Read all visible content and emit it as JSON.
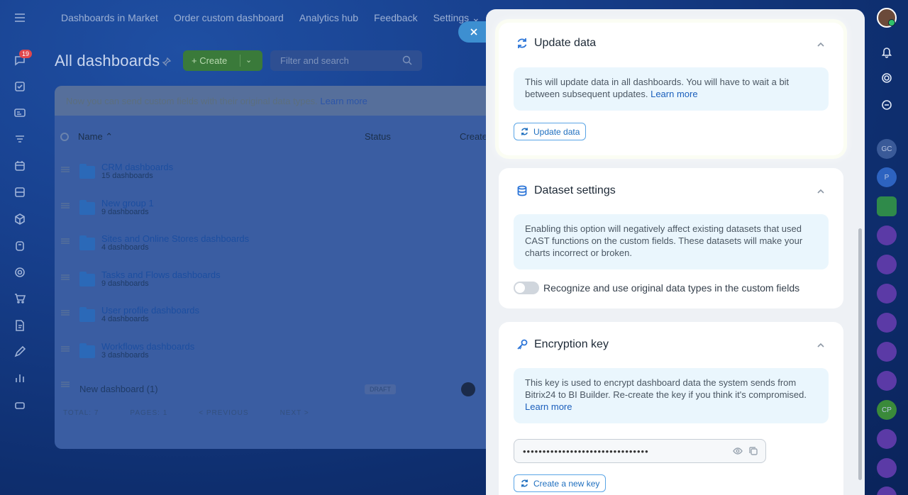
{
  "topnav": {
    "items": [
      "Dashboards in Market",
      "Order custom dashboard",
      "Analytics hub",
      "Feedback",
      "Settings ⌄"
    ]
  },
  "leftrail": {
    "badge_count": "19"
  },
  "page": {
    "title": "All dashboards",
    "create_label": "+ Create",
    "search_placeholder": "Filter and search"
  },
  "notice": {
    "text": "Now you can send custom fields with their original data types. ",
    "link": "Learn more"
  },
  "table": {
    "col_name": "Name ⌃",
    "col_status": "Status",
    "col_created": "Create",
    "rows": [
      {
        "name": "CRM dashboards",
        "sub": "15 dashboards"
      },
      {
        "name": "New group 1",
        "sub": "9 dashboards"
      },
      {
        "name": "Sites and Online Stores dashboards",
        "sub": "4 dashboards"
      },
      {
        "name": "Tasks and Flows dashboards",
        "sub": "9 dashboards"
      },
      {
        "name": "User profile dashboards",
        "sub": "4 dashboards"
      },
      {
        "name": "Workflows dashboards",
        "sub": "3 dashboards"
      }
    ],
    "plain_row": {
      "name": "New dashboard (1)",
      "status": "DRAFT"
    },
    "pager": {
      "total": "TOTAL: 7",
      "pages": "PAGES: 1",
      "prev": "< PREVIOUS",
      "next": "NEXT >"
    }
  },
  "panel": {
    "update": {
      "title": "Update data",
      "info_text": "This will update data in all dashboards. You will have to wait a bit between subsequent updates. ",
      "info_link": "Learn more",
      "button": "Update data"
    },
    "dataset": {
      "title": "Dataset settings",
      "info_text": "Enabling this option will negatively affect existing datasets that used CAST functions on the custom fields. These datasets will make your charts incorrect or broken.",
      "toggle_label": "Recognize and use original data types in the custom fields"
    },
    "encryption": {
      "title": "Encryption key",
      "info_text": "This key is used to encrypt dashboard data the system sends from Bitrix24 to BI Builder. Re-create the key if you think it's compromised. ",
      "info_link": "Learn more",
      "key_value": "••••••••••••••••••••••••••••••••",
      "button": "Create a new key"
    }
  },
  "rightrail": {
    "labels": [
      "GC",
      "P",
      "CP"
    ]
  },
  "colors": {
    "accent": "#2c75d8",
    "info_bg": "#eaf6fd",
    "panel_bg": "#eef1f5"
  }
}
